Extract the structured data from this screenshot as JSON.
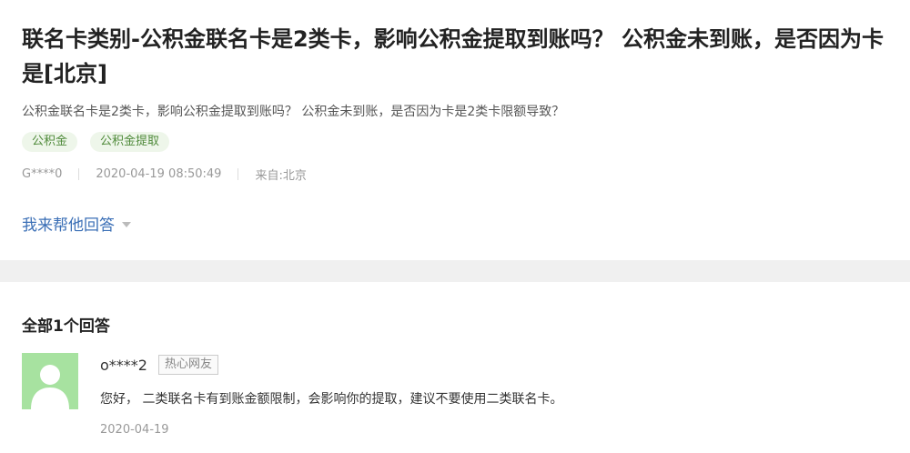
{
  "question": {
    "title": "联名卡类别-公积金联名卡是2类卡，影响公积金提取到账吗？ 公积金未到账，是否因为卡是[北京]",
    "description": "公积金联名卡是2类卡，影响公积金提取到账吗？ 公积金未到账，是否因为卡是2类卡限额导致？",
    "tags": [
      "公积金",
      "公积金提取"
    ],
    "meta": {
      "user": "G****0",
      "datetime": "2020-04-19 08:50:49",
      "location": "来自:北京"
    },
    "help_link": "我来帮他回答"
  },
  "answers_section": {
    "heading": "全部1个回答",
    "answer": {
      "username": "o****2",
      "badge": "热心网友",
      "text": "您好， 二类联名卡有到账金额限制，会影响你的提取，建议不要使用二类联名卡。",
      "date": "2020-04-19"
    }
  },
  "colors": {
    "link": "#3b6fb6",
    "tag_bg": "#eef6ea",
    "tag_text": "#4f8a3a",
    "avatar_bg": "#a7e2a0",
    "divider": "#f0f0f0"
  },
  "icons": {
    "avatar": "default-user-avatar-icon",
    "caret": "caret-down-icon"
  }
}
